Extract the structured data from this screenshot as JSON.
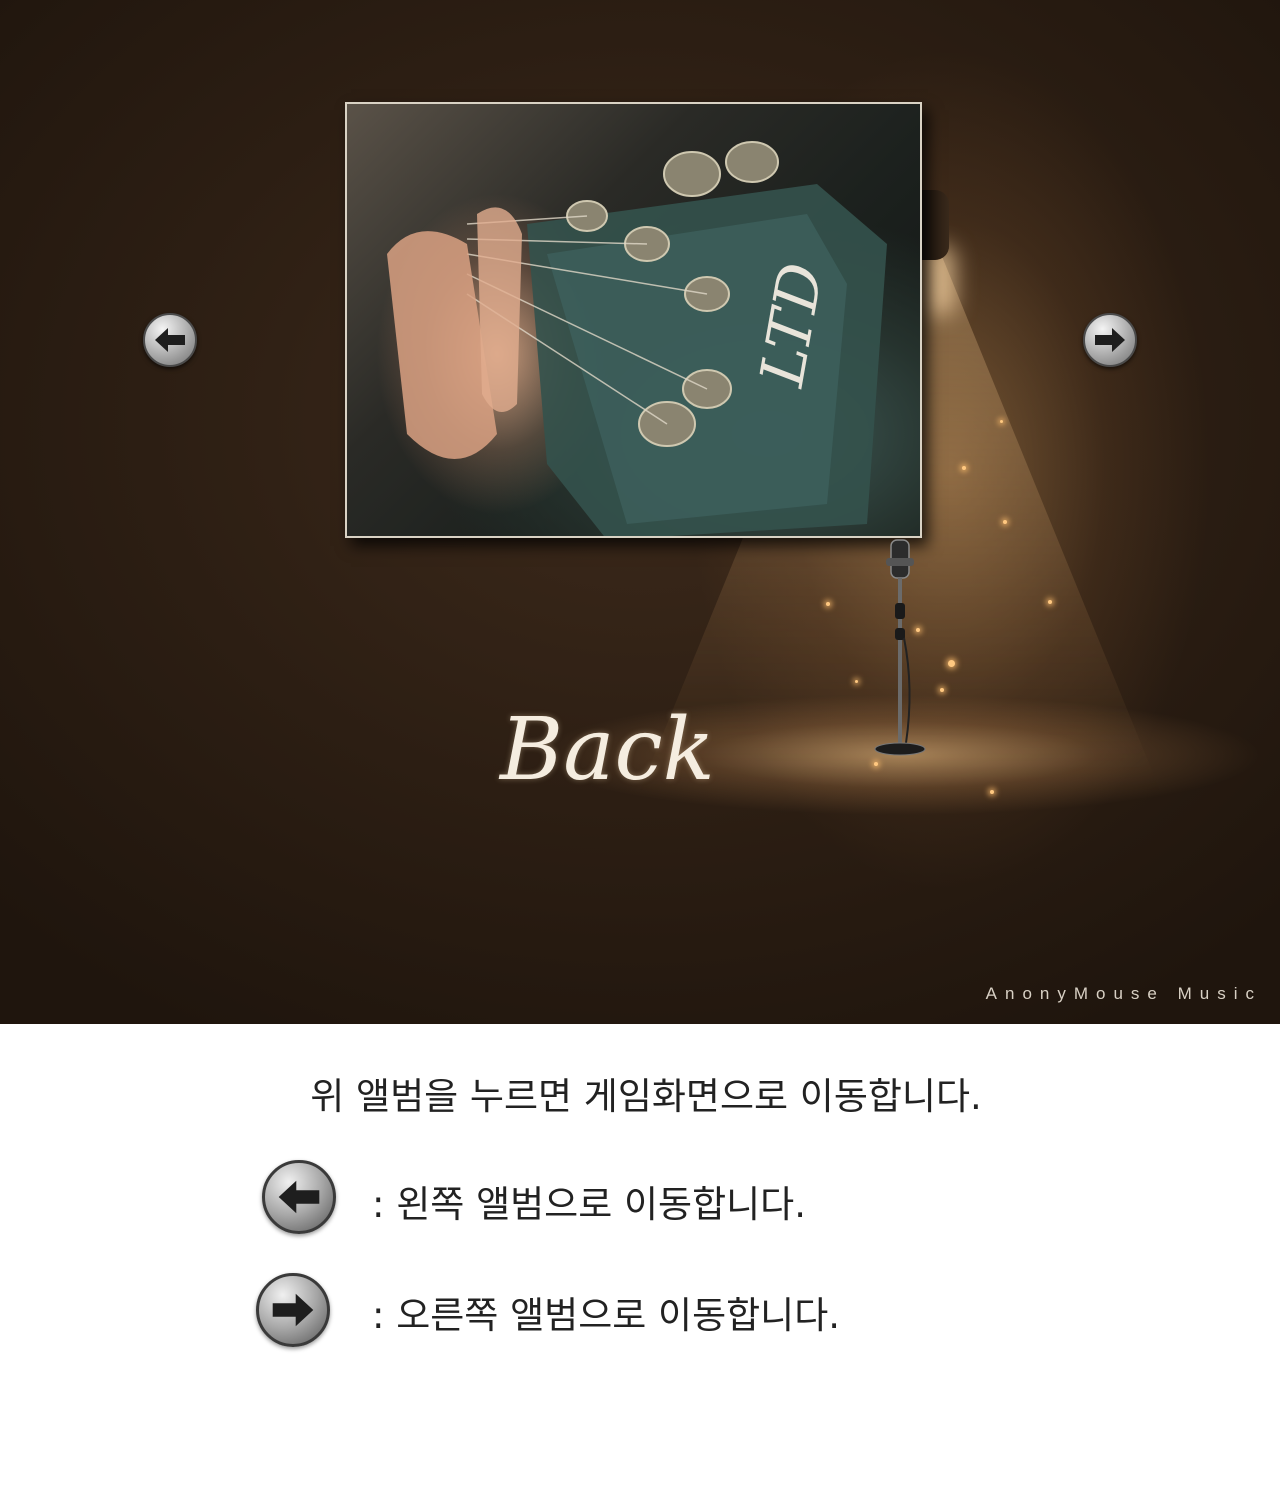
{
  "stage": {
    "album": {
      "image": "guitar-headstock-photo",
      "headstock_logo": "LTD"
    },
    "nav": {
      "left_icon": "arrow-left-icon",
      "right_icon": "arrow-right-icon"
    },
    "back_label": "Back",
    "brand": "AnonyMouse Music"
  },
  "help": {
    "main_text": "위 앨범을 누르면 게임화면으로 이동합니다.",
    "left_text": ": 왼쪽 앨범으로 이동합니다.",
    "right_text": ": 오른쪽 앨범으로 이동합니다."
  }
}
